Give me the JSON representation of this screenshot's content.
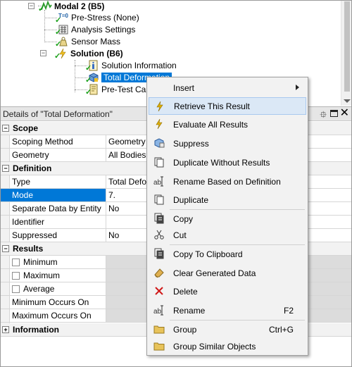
{
  "tree": {
    "items": [
      {
        "label": "Modal 2 (B5)",
        "bold": true
      },
      {
        "label": "Pre-Stress (None)"
      },
      {
        "label": "Analysis Settings"
      },
      {
        "label": "Sensor Mass"
      },
      {
        "label": "Solution (B6)",
        "bold": true
      },
      {
        "label": "Solution Information"
      },
      {
        "label": "Total Deformation"
      },
      {
        "label": "Pre-Test Cal"
      }
    ],
    "prestress_tag": "T=0",
    "expand_minus": "−"
  },
  "details": {
    "title": "Details of \"Total Deformation\"",
    "pin": "⯐",
    "close": "✕",
    "sections": {
      "scope": "Scope",
      "definition": "Definition",
      "results": "Results",
      "information": "Information"
    },
    "toggle_minus": "−",
    "toggle_plus": "+",
    "rows": {
      "scoping_method": {
        "key": "Scoping Method",
        "value": "Geometry"
      },
      "geometry": {
        "key": "Geometry",
        "value": "All Bodies"
      },
      "type": {
        "key": "Type",
        "value": "Total Defo"
      },
      "mode": {
        "key": "Mode",
        "value": "7."
      },
      "separate": {
        "key": "Separate Data by Entity",
        "value": "No"
      },
      "identifier": {
        "key": "Identifier",
        "value": ""
      },
      "suppressed": {
        "key": "Suppressed",
        "value": "No"
      },
      "minimum": {
        "key": "Minimum"
      },
      "maximum": {
        "key": "Maximum"
      },
      "average": {
        "key": "Average"
      },
      "min_occurs": {
        "key": "Minimum Occurs On"
      },
      "max_occurs": {
        "key": "Maximum Occurs On"
      }
    }
  },
  "menu": {
    "items": [
      {
        "label": "Insert",
        "shortcut": "",
        "icon": "none"
      },
      {
        "label": "Retrieve This Result",
        "shortcut": "",
        "icon": "lightning-icon"
      },
      {
        "label": "Evaluate All Results",
        "shortcut": "",
        "icon": "lightning-icon"
      },
      {
        "label": "Suppress",
        "shortcut": "",
        "icon": "suppress-icon"
      },
      {
        "label": "Duplicate Without Results",
        "shortcut": "",
        "icon": "duplicate-icon"
      },
      {
        "label": "Rename Based on Definition",
        "shortcut": "",
        "icon": "rename-icon"
      },
      {
        "label": "Duplicate",
        "shortcut": "",
        "icon": "duplicate-icon"
      },
      {
        "label": "Copy",
        "shortcut": "",
        "icon": "copy-icon"
      },
      {
        "label": "Cut",
        "shortcut": "",
        "icon": "cut-icon"
      },
      {
        "label": "Copy To Clipboard",
        "shortcut": "",
        "icon": "clipboard-icon"
      },
      {
        "label": "Clear Generated Data",
        "shortcut": "",
        "icon": "eraser-icon"
      },
      {
        "label": "Delete",
        "shortcut": "",
        "icon": "delete-icon"
      },
      {
        "label": "Rename",
        "shortcut": "F2",
        "icon": "rename-icon"
      },
      {
        "label": "Group",
        "shortcut": "Ctrl+G",
        "icon": "folder-icon"
      },
      {
        "label": "Group Similar Objects",
        "shortcut": "",
        "icon": "folder-icon"
      }
    ],
    "highlighted": "Retrieve This Result"
  },
  "colors": {
    "selection": "#0078d7",
    "menu_highlight": "#dbe8f6",
    "check_green": "#18a018",
    "lightning": "#e0b000",
    "delete_red": "#d01818"
  }
}
